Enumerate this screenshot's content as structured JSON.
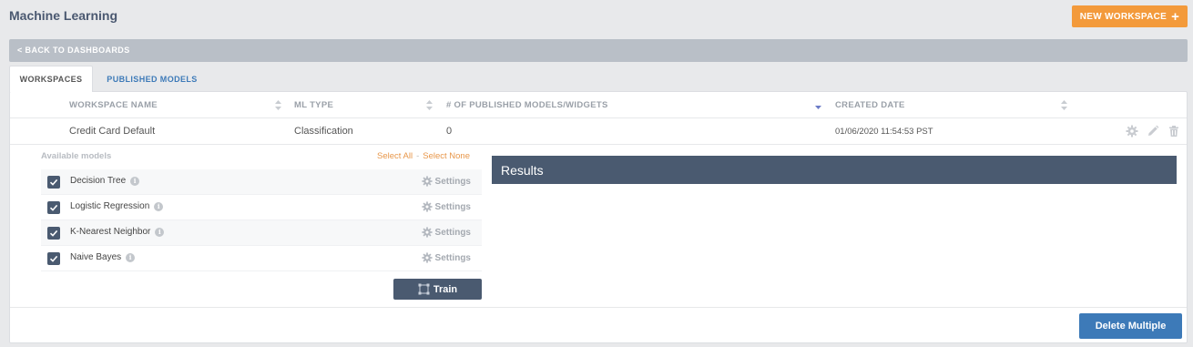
{
  "app": {
    "title": "Machine Learning",
    "new_workspace_label": "NEW WORKSPACE",
    "back_label": "< BACK TO DASHBOARDS"
  },
  "tabs": [
    {
      "label": "WORKSPACES",
      "active": true
    },
    {
      "label": "PUBLISHED MODELS",
      "active": false
    }
  ],
  "table": {
    "columns": [
      "WORKSPACE NAME",
      "ML TYPE",
      "# OF PUBLISHED MODELS/WIDGETS",
      "CREATED DATE"
    ],
    "rows": [
      {
        "name": "Credit Card Default",
        "ml_type": "Classification",
        "published_count": "0",
        "created": "01/06/2020 11:54:53 PST",
        "icons": [
          "gear-icon",
          "pencil-icon",
          "trash-icon"
        ]
      }
    ]
  },
  "models_panel": {
    "title": "Available models",
    "select_all": "Select All",
    "separator": "-",
    "select_none": "Select None",
    "settings_label": "Settings",
    "models": [
      {
        "name": "Decision Tree",
        "checked": true
      },
      {
        "name": "Logistic Regression",
        "checked": true
      },
      {
        "name": "K-Nearest Neighbor",
        "checked": true
      },
      {
        "name": "Naive Bayes",
        "checked": true
      }
    ],
    "train_label": "Train"
  },
  "results": {
    "title": "Results"
  },
  "footer": {
    "delete_multiple_label": "Delete Multiple"
  },
  "colors": {
    "accent_orange": "#f39a3b",
    "primary_blue": "#3d7ab8",
    "slate": "#4a5a70",
    "link_orange": "#e8974a"
  }
}
